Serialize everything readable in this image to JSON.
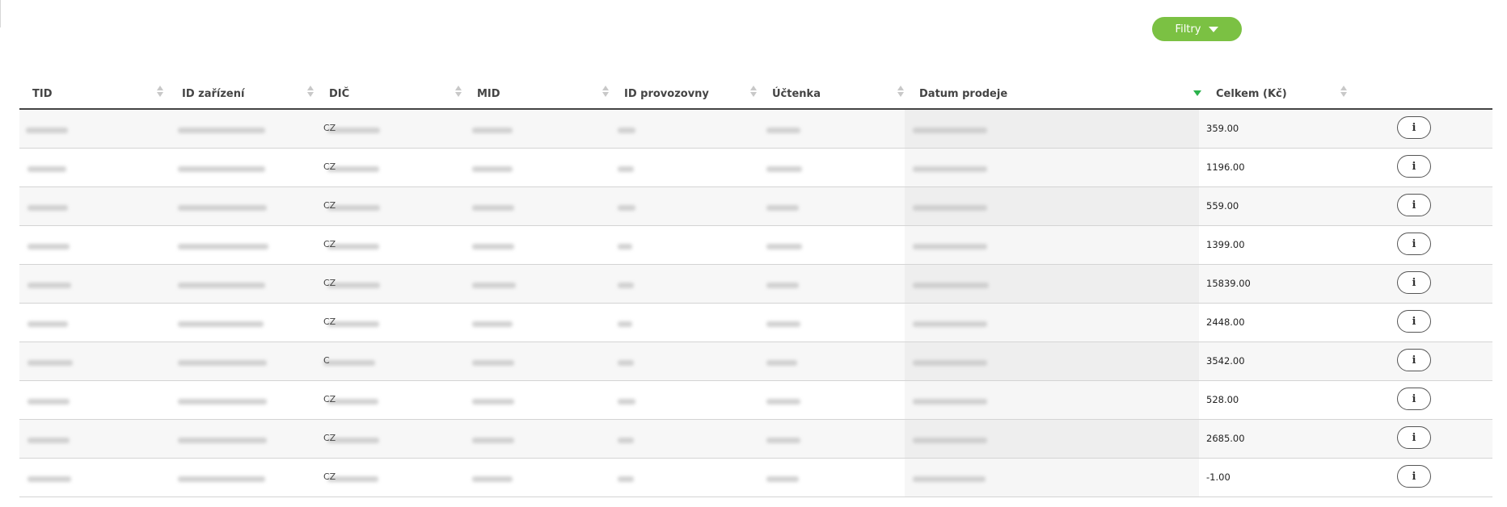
{
  "toolbar": {
    "filter_label": "Filtry",
    "filter_icon": "caret-down-icon"
  },
  "table": {
    "columns": [
      {
        "key": "tid",
        "label": "TID",
        "sort": "none"
      },
      {
        "key": "device",
        "label": "ID zařízení",
        "sort": "none"
      },
      {
        "key": "dic",
        "label": "DIČ",
        "sort": "none"
      },
      {
        "key": "mid",
        "label": "MID",
        "sort": "none"
      },
      {
        "key": "shop",
        "label": "ID provozovny",
        "sort": "none"
      },
      {
        "key": "receipt",
        "label": "Účtenka",
        "sort": "none"
      },
      {
        "key": "date",
        "label": "Datum prodeje",
        "sort": "descending"
      },
      {
        "key": "total",
        "label": "Celkem (Kč)",
        "sort": "none"
      }
    ],
    "rows": [
      {
        "dic_prefix": "CZ",
        "total": "359.00"
      },
      {
        "dic_prefix": "CZ",
        "total": "1196.00"
      },
      {
        "dic_prefix": "CZ",
        "total": "559.00"
      },
      {
        "dic_prefix": "CZ",
        "total": "1399.00"
      },
      {
        "dic_prefix": "CZ",
        "total": "15839.00"
      },
      {
        "dic_prefix": "CZ",
        "total": "2448.00"
      },
      {
        "dic_prefix": "C",
        "total": "3542.00"
      },
      {
        "dic_prefix": "CZ",
        "total": "528.00"
      },
      {
        "dic_prefix": "CZ",
        "total": "2685.00"
      },
      {
        "dic_prefix": "CZ",
        "total": "-1.00"
      }
    ],
    "info_button_label": "i",
    "info_button_icon": "info-icon"
  }
}
